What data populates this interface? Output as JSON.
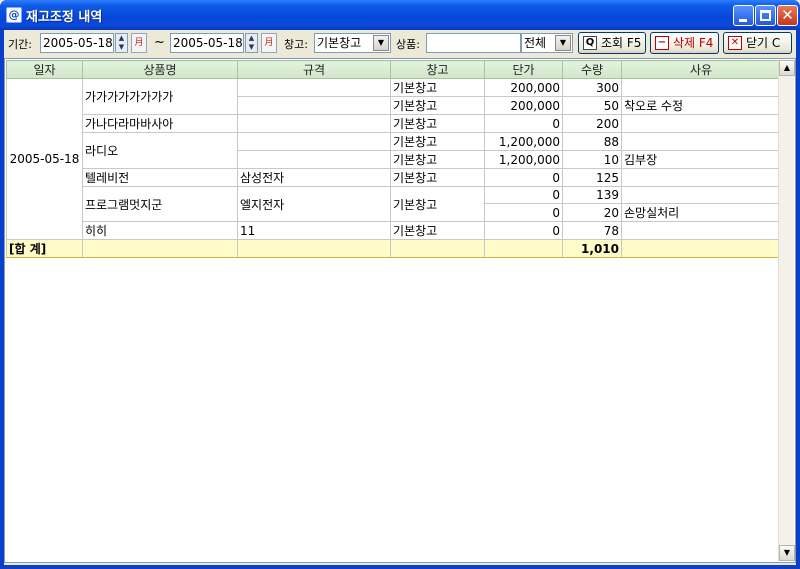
{
  "window": {
    "icon": "@",
    "title": "재고조정 내역"
  },
  "toolbar": {
    "period_label": "기간:",
    "date_from": "2005-05-18",
    "tilde": "~",
    "date_to": "2005-05-18",
    "warehouse_label": "창고:",
    "warehouse_value": "기본창고",
    "product_label": "상품:",
    "product_value": "",
    "product_filter_value": "전체",
    "search_label": "조회 F5",
    "delete_label": "삭제 F4",
    "close_label": "닫기 C",
    "calendar_glyph": "月"
  },
  "grid": {
    "headers": [
      "일자",
      "상품명",
      "규격",
      "창고",
      "단가",
      "수량",
      "사유"
    ],
    "date_cell": "2005-05-18",
    "rows": [
      {
        "product": "가가가가가가가가",
        "spec": "",
        "warehouse": "기본창고",
        "price": "200,000",
        "qty": "300",
        "reason": ""
      },
      {
        "product": "",
        "spec": "",
        "warehouse": "기본창고",
        "price": "200,000",
        "qty": "50",
        "reason": "착오로 수정"
      },
      {
        "product": "가나다라마바사아",
        "spec": "",
        "warehouse": "기본창고",
        "price": "0",
        "qty": "200",
        "reason": ""
      },
      {
        "product": "라디오",
        "spec": "",
        "warehouse": "기본창고",
        "price": "1,200,000",
        "qty": "88",
        "reason": ""
      },
      {
        "product": "",
        "spec": "",
        "warehouse": "기본창고",
        "price": "1,200,000",
        "qty": "10",
        "reason": "김부장"
      },
      {
        "product": "텔레비전",
        "spec": "삼성전자",
        "warehouse": "기본창고",
        "price": "0",
        "qty": "125",
        "reason": ""
      },
      {
        "product": "프로그램멋지군",
        "spec": "엘지전자",
        "warehouse": "기본창고",
        "price": "0",
        "qty": "139",
        "reason": ""
      },
      {
        "product": "",
        "spec": "",
        "warehouse": "",
        "price": "0",
        "qty": "20",
        "reason": "손망실처리"
      },
      {
        "product": "히히",
        "spec": "11",
        "warehouse": "기본창고",
        "price": "0",
        "qty": "78",
        "reason": ""
      }
    ],
    "total_label": "[합 계]",
    "total_qty": "1,010"
  }
}
